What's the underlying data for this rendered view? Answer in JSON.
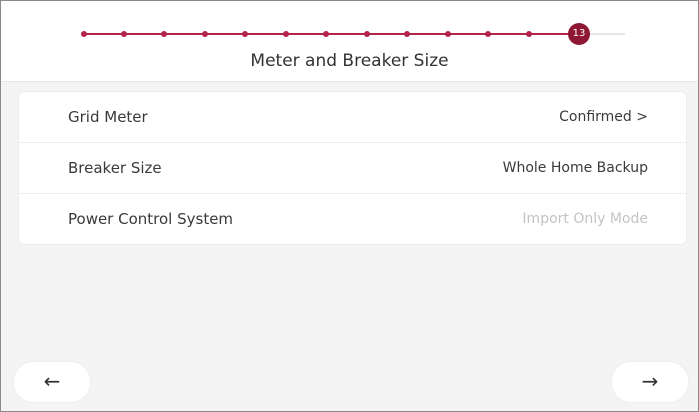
{
  "header": {
    "title": "Meter and Breaker Size",
    "progress": {
      "current_step": "13",
      "total_steps": 14,
      "accent_color": "#b3234a",
      "current_color": "#8e1733"
    }
  },
  "settings": [
    {
      "label": "Grid Meter",
      "value": "Confirmed >",
      "enabled": true
    },
    {
      "label": "Breaker Size",
      "value": "Whole Home Backup",
      "enabled": true
    },
    {
      "label": "Power Control System",
      "value": "Import Only Mode",
      "enabled": false
    }
  ],
  "navigation": {
    "back_icon": "←",
    "next_icon": "→"
  }
}
